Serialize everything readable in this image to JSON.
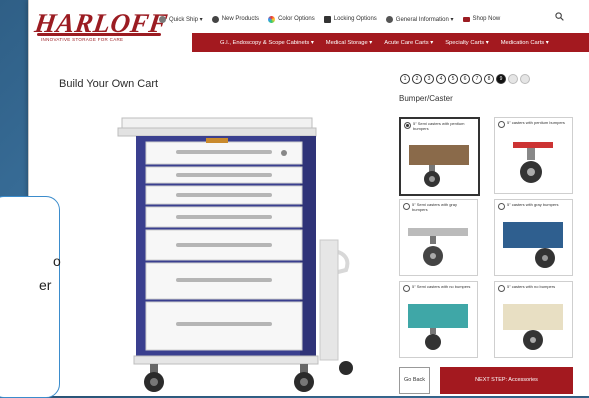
{
  "header": {
    "logo": {
      "word": "HARLOFF",
      "tagline": "INNOVATIVE STORAGE FOR CARE"
    },
    "top_links": [
      {
        "label": "Quick Ship ▾",
        "icon": "quick-ship-icon"
      },
      {
        "label": "New Products",
        "icon": "new-products-icon"
      },
      {
        "label": "Color Options",
        "icon": "color-options-icon"
      },
      {
        "label": "Locking Options",
        "icon": "lock-icon"
      },
      {
        "label": "General Information ▾",
        "icon": "info-icon"
      },
      {
        "label": "Shop Now",
        "icon": "cart-icon"
      }
    ],
    "nav": [
      "G.I., Endoscopy & Scope Cabinets ▾",
      "Medical Storage ▾",
      "Acute Care Carts ▾",
      "Specialty Carts ▾",
      "Medication Carts ▾"
    ]
  },
  "main": {
    "title": "Build Your Own Cart",
    "steps": [
      "1",
      "2",
      "3",
      "4",
      "5",
      "6",
      "7",
      "8",
      "9",
      "10",
      "11"
    ],
    "active_step": 9,
    "section_label": "Bumper/Caster",
    "options": [
      {
        "label": "5\" Semi casters with pentium bumpers",
        "selected": true
      },
      {
        "label": "5\" casters with pentium bumpers",
        "selected": false
      },
      {
        "label": "5\" Semi casters with gray bumpers",
        "selected": false
      },
      {
        "label": "5\" casters with gray bumpers",
        "selected": false
      },
      {
        "label": "5\" Semi casters with no bumpers",
        "selected": false
      },
      {
        "label": "5\" casters with no bumpers",
        "selected": false
      }
    ],
    "go_back": "Go Back",
    "next_step": "NEXT STEP: Accessories"
  },
  "callout": {
    "line1": "o",
    "line2": "er"
  },
  "colors": {
    "brand_red": "#a3191f",
    "cart_navy": "#3a3f8f",
    "callout_border": "#3b8ccc"
  }
}
